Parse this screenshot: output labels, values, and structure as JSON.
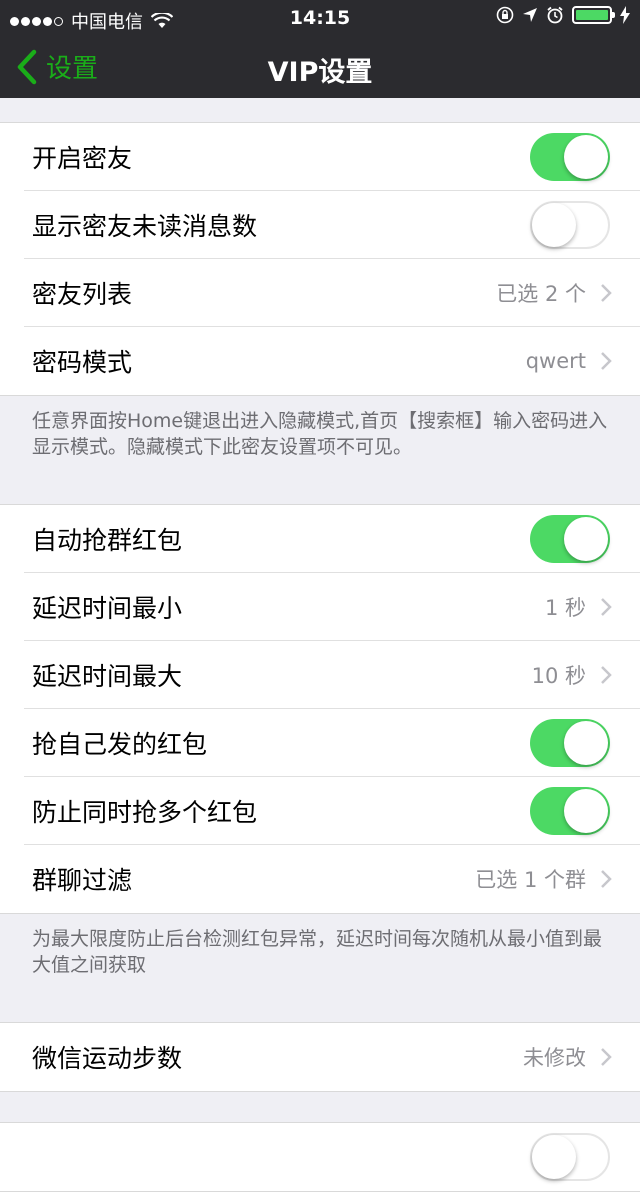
{
  "status": {
    "carrier": "中国电信",
    "time": "14:15",
    "signal_bars": [
      true,
      true,
      true,
      true,
      false
    ]
  },
  "nav": {
    "back_label": "设置",
    "title": "VIP设置",
    "accent": "#1aad19"
  },
  "groups": [
    {
      "rows": [
        {
          "label": "开启密友",
          "type": "toggle",
          "on": true
        },
        {
          "label": "显示密友未读消息数",
          "type": "toggle",
          "on": false
        },
        {
          "label": "密友列表",
          "type": "value",
          "value": "已选 2 个"
        },
        {
          "label": "密码模式",
          "type": "value",
          "value": "qwert"
        }
      ],
      "footnote": "任意界面按Home键退出进入隐藏模式,首页【搜索框】输入密码进入显示模式。隐藏模式下此密友设置项不可见。"
    },
    {
      "rows": [
        {
          "label": "自动抢群红包",
          "type": "toggle",
          "on": true
        },
        {
          "label": "延迟时间最小",
          "type": "value",
          "value": "1 秒"
        },
        {
          "label": "延迟时间最大",
          "type": "value",
          "value": "10 秒"
        },
        {
          "label": "抢自己发的红包",
          "type": "toggle",
          "on": true
        },
        {
          "label": "防止同时抢多个红包",
          "type": "toggle",
          "on": true
        },
        {
          "label": "群聊过滤",
          "type": "value",
          "value": "已选 1 个群"
        }
      ],
      "footnote": "为最大限度防止后台检测红包异常，延迟时间每次随机从最小值到最大值之间获取"
    },
    {
      "rows": [
        {
          "label": "微信运动步数",
          "type": "value",
          "value": "未修改"
        }
      ]
    },
    {
      "rows": [
        {
          "label": "",
          "type": "toggle",
          "on": false
        }
      ]
    }
  ],
  "colors": {
    "toggle_on": "#4cd964",
    "nav_bg": "#2b2b2f",
    "page_bg": "#efeff4"
  }
}
